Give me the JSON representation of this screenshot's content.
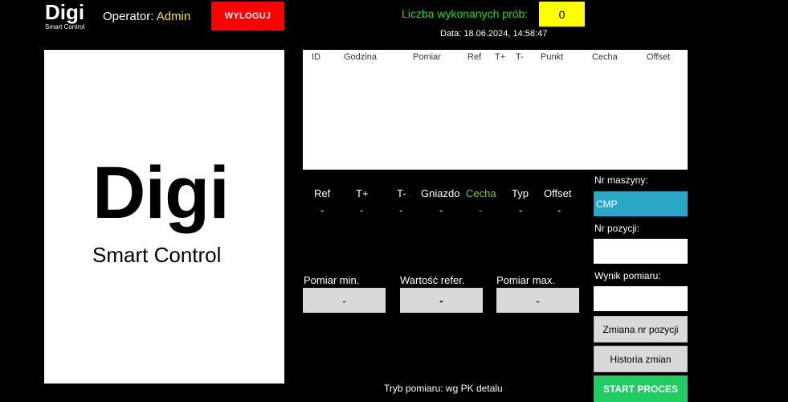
{
  "header": {
    "logo_big": "Digi",
    "logo_sub": "Smart Control",
    "operator_label": "Operator:",
    "operator_name": "Admin",
    "logout_label": "WYLOGUJ",
    "counter_label": "Liczba wykonanych prób:",
    "counter_value": "0",
    "datetime": "Data: 18.06.2024, 14:58:47"
  },
  "logo_panel": {
    "big": "Digi",
    "sub": "Smart Control"
  },
  "results_table": {
    "columns": [
      "ID",
      "Godzina",
      "Pomiar",
      "Ref",
      "T+",
      "T-",
      "Punkt",
      "Cecha",
      "Offset"
    ],
    "rows": []
  },
  "info": {
    "headers": [
      "Ref",
      "T+",
      "T-",
      "Gniazdo",
      "Cecha",
      "Typ",
      "Offset"
    ],
    "values": [
      "-",
      "-",
      "-",
      "-",
      "-",
      "-",
      "-"
    ]
  },
  "measurement": {
    "min_label": "Pomiar min.",
    "min_value": "-",
    "ref_label": "Wartość refer.",
    "ref_value": "-",
    "max_label": "Pomiar max.",
    "max_value": "-"
  },
  "side": {
    "machine_label": "Nr maszyny:",
    "machine_value": "CMP",
    "position_label": "Nr pozycji:",
    "position_value": "",
    "result_label": "Wynik pomiaru:",
    "result_value": "",
    "change_position_label": "Zmiana nr pozycji",
    "history_label": "Historia zmian",
    "start_label": "START PROCES"
  },
  "mode": {
    "label": "Tryb pomiaru:",
    "value": "wg PK detalu"
  },
  "colors": {
    "logout": "#ff0000",
    "counter_box": "#ffff00",
    "counter_label": "#25d525",
    "operator_name": "#f5e626",
    "machine_field": "#2aa7c7",
    "start_button": "#1fcd62",
    "cecha_header": "#72c93d"
  }
}
